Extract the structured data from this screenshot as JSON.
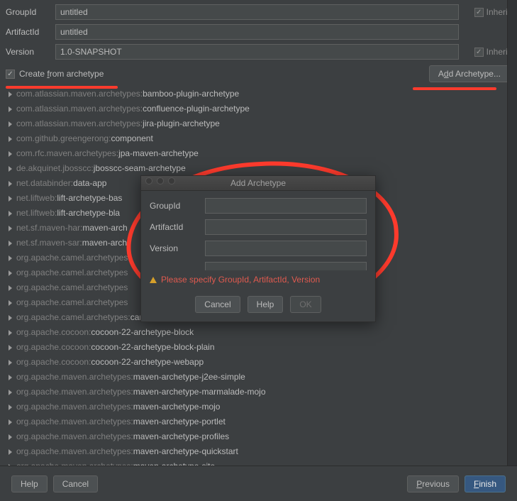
{
  "fields": {
    "groupId": {
      "label": "GroupId",
      "value": "untitled",
      "inherit": "Inherit"
    },
    "artifactId": {
      "label": "ArtifactId",
      "value": "untitled"
    },
    "version": {
      "label": "Version",
      "value": "1.0-SNAPSHOT",
      "inherit": "Inherit"
    }
  },
  "createFromArchetype": {
    "label_pre": "Create ",
    "label_u": "f",
    "label_post": "rom archetype"
  },
  "addArchetypeBtn": {
    "pre": "A",
    "u": "d",
    "post": "d Archetype..."
  },
  "archetypes": [
    {
      "pkg": "com.atlassian.maven.archetypes:",
      "name": "bamboo-plugin-archetype"
    },
    {
      "pkg": "com.atlassian.maven.archetypes:",
      "name": "confluence-plugin-archetype"
    },
    {
      "pkg": "com.atlassian.maven.archetypes:",
      "name": "jira-plugin-archetype"
    },
    {
      "pkg": "com.github.greengerong:",
      "name": "component"
    },
    {
      "pkg": "com.rfc.maven.archetypes:",
      "name": "jpa-maven-archetype"
    },
    {
      "pkg": "de.akquinet.jbosscc:",
      "name": "jbosscc-seam-archetype"
    },
    {
      "pkg": "net.databinder:",
      "name": "data-app"
    },
    {
      "pkg": "net.liftweb:",
      "name": "lift-archetype-bas"
    },
    {
      "pkg": "net.liftweb:",
      "name": "lift-archetype-bla"
    },
    {
      "pkg": "net.sf.maven-har:",
      "name": "maven-arch"
    },
    {
      "pkg": "net.sf.maven-sar:",
      "name": "maven-arch"
    },
    {
      "pkg": "org.apache.camel.archetypes",
      "name": ""
    },
    {
      "pkg": "org.apache.camel.archetypes",
      "name": ""
    },
    {
      "pkg": "org.apache.camel.archetypes",
      "name": ""
    },
    {
      "pkg": "org.apache.camel.archetypes",
      "name": ""
    },
    {
      "pkg": "org.apache.camel.archetypes:",
      "name": "camel-archetype-war"
    },
    {
      "pkg": "org.apache.cocoon:",
      "name": "cocoon-22-archetype-block"
    },
    {
      "pkg": "org.apache.cocoon:",
      "name": "cocoon-22-archetype-block-plain"
    },
    {
      "pkg": "org.apache.cocoon:",
      "name": "cocoon-22-archetype-webapp"
    },
    {
      "pkg": "org.apache.maven.archetypes:",
      "name": "maven-archetype-j2ee-simple"
    },
    {
      "pkg": "org.apache.maven.archetypes:",
      "name": "maven-archetype-marmalade-mojo"
    },
    {
      "pkg": "org.apache.maven.archetypes:",
      "name": "maven-archetype-mojo"
    },
    {
      "pkg": "org.apache.maven.archetypes:",
      "name": "maven-archetype-portlet"
    },
    {
      "pkg": "org.apache.maven.archetypes:",
      "name": "maven-archetype-profiles"
    },
    {
      "pkg": "org.apache.maven.archetypes:",
      "name": "maven-archetype-quickstart"
    },
    {
      "pkg": "org.apache.maven.archetypes:",
      "name": "maven-archetype-site"
    }
  ],
  "dialog": {
    "title": "Add Archetype",
    "groupId": "GroupId",
    "artifactId": "ArtifactId",
    "version": "Version",
    "message": "Please specify GroupId, ArtifactId, Version",
    "cancel": "Cancel",
    "help": "Help",
    "ok": "OK"
  },
  "bottom": {
    "help": "Help",
    "cancel": "Cancel",
    "previous_u": "P",
    "previous_post": "revious",
    "finish_u": "F",
    "finish_post": "inish"
  }
}
